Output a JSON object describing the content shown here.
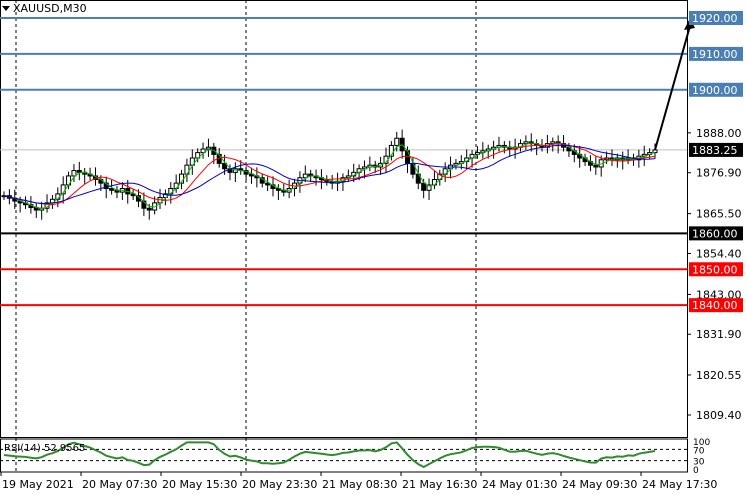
{
  "window": {
    "symbol": "XAUUSD,M30"
  },
  "price_axis": {
    "labels": [
      "1888.00",
      "1876.90",
      "1865.50",
      "1854.40",
      "1843.00",
      "1831.90",
      "1820.55",
      "1809.40"
    ]
  },
  "levels": [
    {
      "label": "1920.00",
      "value": 1920.0,
      "color": "#4a7fb5"
    },
    {
      "label": "1910.00",
      "value": 1910.0,
      "color": "#4a7fb5"
    },
    {
      "label": "1900.00",
      "value": 1900.0,
      "color": "#4a7fb5"
    },
    {
      "label": "1860.00",
      "value": 1860.0,
      "color": "#000000"
    },
    {
      "label": "1850.00",
      "value": 1850.0,
      "color": "#ff0000"
    },
    {
      "label": "1840.00",
      "value": 1840.0,
      "color": "#ff0000"
    }
  ],
  "current_price": {
    "label": "1883.25",
    "value": 1883.25
  },
  "rsi": {
    "label": "RSI(14) 52.9565",
    "scale_labels": [
      "100",
      "70",
      "30",
      "0"
    ],
    "color": "#2e8b2e"
  },
  "time_axis": {
    "labels": [
      "19 May 2021",
      "20 May 07:30",
      "20 May 15:30",
      "20 May 23:30",
      "21 May 08:30",
      "21 May 16:30",
      "24 May 01:30",
      "24 May 09:30",
      "24 May 17:30"
    ]
  },
  "chart_data": {
    "type": "candlestick",
    "symbol": "XAUUSD",
    "timeframe": "M30",
    "ylim": [
      1809.4,
      1920.0
    ],
    "closes": [
      1870.5,
      1869.8,
      1869.0,
      1868.5,
      1868.0,
      1867.2,
      1866.5,
      1867.0,
      1868.5,
      1869.5,
      1871.0,
      1873.5,
      1876.0,
      1877.5,
      1877.0,
      1876.5,
      1876.0,
      1875.0,
      1874.0,
      1872.5,
      1872.0,
      1871.5,
      1872.5,
      1871.0,
      1870.5,
      1869.0,
      1867.0,
      1866.5,
      1868.5,
      1870.0,
      1871.0,
      1872.5,
      1874.0,
      1876.5,
      1879.0,
      1881.0,
      1882.5,
      1883.5,
      1884.0,
      1882.0,
      1879.5,
      1878.0,
      1877.0,
      1878.0,
      1877.5,
      1876.5,
      1876.0,
      1875.5,
      1874.0,
      1873.5,
      1872.5,
      1872.0,
      1871.5,
      1872.5,
      1874.0,
      1875.5,
      1876.5,
      1876.0,
      1875.5,
      1875.0,
      1874.5,
      1874.0,
      1874.5,
      1875.5,
      1876.0,
      1877.0,
      1878.0,
      1878.5,
      1879.0,
      1878.5,
      1879.5,
      1881.5,
      1884.5,
      1886.5,
      1883.0,
      1879.5,
      1876.5,
      1874.0,
      1872.0,
      1873.5,
      1875.0,
      1876.5,
      1878.0,
      1879.0,
      1879.5,
      1880.0,
      1881.0,
      1882.0,
      1882.5,
      1883.0,
      1883.5,
      1884.0,
      1884.5,
      1884.0,
      1883.5,
      1884.0,
      1885.0,
      1885.5,
      1885.0,
      1884.5,
      1884.0,
      1885.0,
      1885.5,
      1885.0,
      1884.0,
      1883.0,
      1882.0,
      1881.0,
      1880.0,
      1879.0,
      1878.5,
      1880.5,
      1881.0,
      1880.5,
      1881.0,
      1880.5,
      1881.0,
      1880.5,
      1881.5,
      1882.0,
      1882.5,
      1883.25
    ],
    "level_lines": [
      1920.0,
      1910.0,
      1900.0,
      1860.0,
      1850.0,
      1840.0
    ],
    "projection_target": 1920.0
  }
}
